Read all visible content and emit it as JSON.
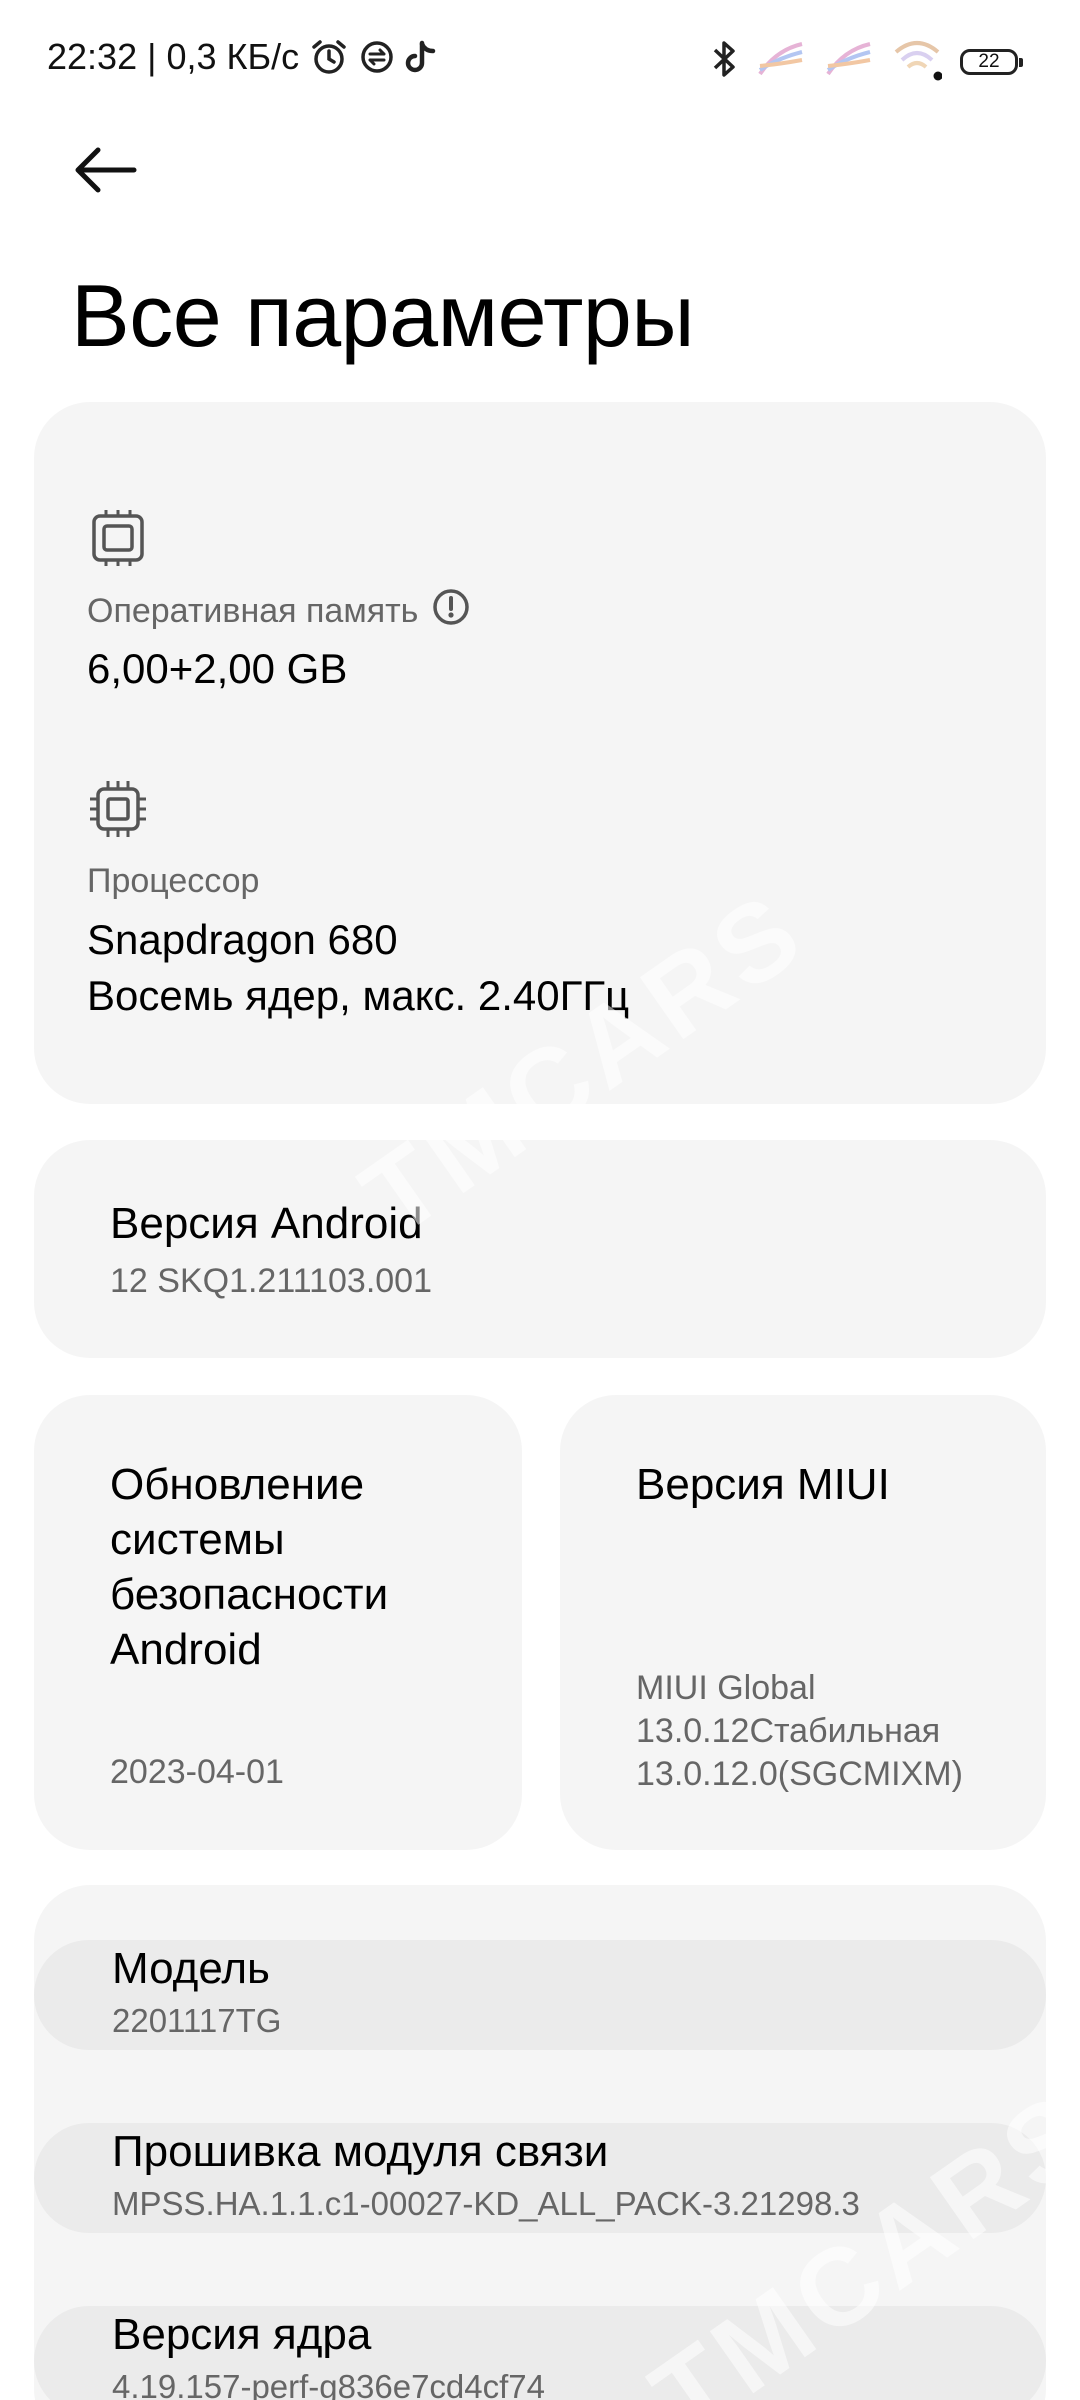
{
  "status_bar": {
    "time_speed": "22:32 | 0,3 КБ/с",
    "icons": [
      "alarm-icon",
      "sync-icon",
      "tiktok-icon",
      "bluetooth-icon",
      "signal-icon",
      "signal-icon",
      "wifi-icon"
    ],
    "battery": "22"
  },
  "header": {
    "title": "Все параметры"
  },
  "hardware": {
    "ram": {
      "label": "Оперативная память",
      "value": "6,00+2,00 GB"
    },
    "cpu": {
      "label": "Процессор",
      "value_line1": "Snapdragon 680",
      "value_line2": "Восемь ядер, макс. 2.40ГГц"
    }
  },
  "android": {
    "title": "Версия Android",
    "value": "12 SKQ1.211103.001"
  },
  "security": {
    "title_lines": [
      "Обновление",
      "системы",
      "безопасности",
      "Android"
    ],
    "value": "2023-04-01"
  },
  "miui": {
    "title": "Версия MIUI",
    "value_lines": [
      "MIUI Global",
      "13.0.12Стабильная",
      "13.0.12.0(SGCMIXM)"
    ]
  },
  "list": [
    {
      "title": "Модель",
      "value": "2201117TG"
    },
    {
      "title": "Прошивка модуля связи",
      "value": "MPSS.HA.1.1.c1-00027-KD_ALL_PACK-3.21298.3"
    },
    {
      "title": "Версия ядра",
      "value": "4.19.157-perf-g836e7cd4cf74"
    }
  ],
  "watermark": "TMCARS",
  "colors": {
    "card_bg": "#f5f5f5",
    "row_bg": "#ebebeb",
    "secondary_text": "#666666",
    "primary_text": "#000000"
  }
}
